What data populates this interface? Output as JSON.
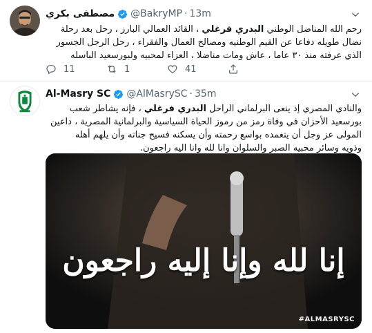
{
  "tweets": [
    {
      "display_name": "مصطفى بكري",
      "handle": "@BakryMP",
      "dot": "·",
      "time": "13m",
      "text_line1_a": "رحم الله المناضل الوطني ",
      "text_line1_bold": "البدري فرغلي",
      "text_line1_b": " ، القائد العمالي البارز ، رحل بعد رحلة",
      "text_line2": "نضال طويله دفاعا عن القيم الوطنيه ومصالح العمال والفقراء ، رحل الرجل الجسور",
      "text_line3": "الذي عرفته منذ ٣٠ عاما ، عاش ومات مناضلا ، العزاء لمحبيه ولبورسعيد الباسله",
      "replies": "11",
      "retweets": "1",
      "likes": "41"
    },
    {
      "display_name": "Al-Masry SC",
      "handle": "@AlMasrySC",
      "dot": "·",
      "time": "35m",
      "text_line1_a": "والنادي المصري إذ ينعى البرلماني الراحل ",
      "text_line1_bold": "البدري فرغلي",
      "text_line1_b": " ، فإنه يشاطر شعب",
      "text_line2": "بورسعيد الأحزان في وفاة رمز من رموز الحياة السياسية والبرلمانية المصرية ، داعين",
      "text_line3": "المولى عز وجل أن يتغمده بواسع رحمته وأن يسكنه فسيح جناته وأن يلهم أهله",
      "text_line4": "وذويه وسائر محبيه الصبر والسلوان وانا لله وانا اليه راجعون.",
      "media_caption": "إنا لله وإنا إليه راجعون",
      "media_watermark": "#ALMASRYSC"
    }
  ],
  "colors": {
    "verified": "#1d9bf0",
    "muted": "#536471",
    "club_green": "#0a8a3a"
  },
  "icons": [
    "verified-badge-icon",
    "chevron-down-icon",
    "reply-icon",
    "retweet-icon",
    "like-icon",
    "share-icon"
  ]
}
